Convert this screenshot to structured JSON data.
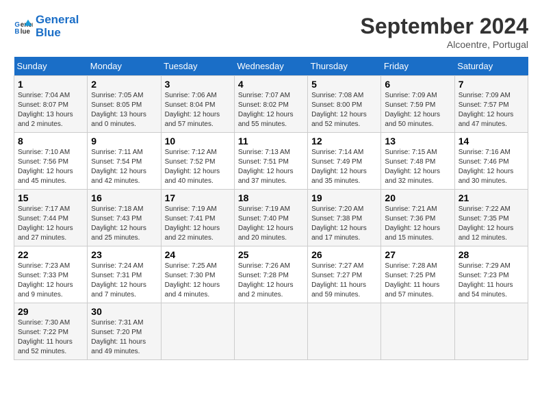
{
  "header": {
    "logo_line1": "General",
    "logo_line2": "Blue",
    "month": "September 2024",
    "location": "Alcoentre, Portugal"
  },
  "days_of_week": [
    "Sunday",
    "Monday",
    "Tuesday",
    "Wednesday",
    "Thursday",
    "Friday",
    "Saturday"
  ],
  "weeks": [
    [
      {
        "day": 1,
        "sunrise": "7:04 AM",
        "sunset": "8:07 PM",
        "daylight": "13 hours and 2 minutes"
      },
      {
        "day": 2,
        "sunrise": "7:05 AM",
        "sunset": "8:05 PM",
        "daylight": "13 hours and 0 minutes"
      },
      {
        "day": 3,
        "sunrise": "7:06 AM",
        "sunset": "8:04 PM",
        "daylight": "12 hours and 57 minutes"
      },
      {
        "day": 4,
        "sunrise": "7:07 AM",
        "sunset": "8:02 PM",
        "daylight": "12 hours and 55 minutes"
      },
      {
        "day": 5,
        "sunrise": "7:08 AM",
        "sunset": "8:00 PM",
        "daylight": "12 hours and 52 minutes"
      },
      {
        "day": 6,
        "sunrise": "7:09 AM",
        "sunset": "7:59 PM",
        "daylight": "12 hours and 50 minutes"
      },
      {
        "day": 7,
        "sunrise": "7:09 AM",
        "sunset": "7:57 PM",
        "daylight": "12 hours and 47 minutes"
      }
    ],
    [
      {
        "day": 8,
        "sunrise": "7:10 AM",
        "sunset": "7:56 PM",
        "daylight": "12 hours and 45 minutes"
      },
      {
        "day": 9,
        "sunrise": "7:11 AM",
        "sunset": "7:54 PM",
        "daylight": "12 hours and 42 minutes"
      },
      {
        "day": 10,
        "sunrise": "7:12 AM",
        "sunset": "7:52 PM",
        "daylight": "12 hours and 40 minutes"
      },
      {
        "day": 11,
        "sunrise": "7:13 AM",
        "sunset": "7:51 PM",
        "daylight": "12 hours and 37 minutes"
      },
      {
        "day": 12,
        "sunrise": "7:14 AM",
        "sunset": "7:49 PM",
        "daylight": "12 hours and 35 minutes"
      },
      {
        "day": 13,
        "sunrise": "7:15 AM",
        "sunset": "7:48 PM",
        "daylight": "12 hours and 32 minutes"
      },
      {
        "day": 14,
        "sunrise": "7:16 AM",
        "sunset": "7:46 PM",
        "daylight": "12 hours and 30 minutes"
      }
    ],
    [
      {
        "day": 15,
        "sunrise": "7:17 AM",
        "sunset": "7:44 PM",
        "daylight": "12 hours and 27 minutes"
      },
      {
        "day": 16,
        "sunrise": "7:18 AM",
        "sunset": "7:43 PM",
        "daylight": "12 hours and 25 minutes"
      },
      {
        "day": 17,
        "sunrise": "7:19 AM",
        "sunset": "7:41 PM",
        "daylight": "12 hours and 22 minutes"
      },
      {
        "day": 18,
        "sunrise": "7:19 AM",
        "sunset": "7:40 PM",
        "daylight": "12 hours and 20 minutes"
      },
      {
        "day": 19,
        "sunrise": "7:20 AM",
        "sunset": "7:38 PM",
        "daylight": "12 hours and 17 minutes"
      },
      {
        "day": 20,
        "sunrise": "7:21 AM",
        "sunset": "7:36 PM",
        "daylight": "12 hours and 15 minutes"
      },
      {
        "day": 21,
        "sunrise": "7:22 AM",
        "sunset": "7:35 PM",
        "daylight": "12 hours and 12 minutes"
      }
    ],
    [
      {
        "day": 22,
        "sunrise": "7:23 AM",
        "sunset": "7:33 PM",
        "daylight": "12 hours and 9 minutes"
      },
      {
        "day": 23,
        "sunrise": "7:24 AM",
        "sunset": "7:31 PM",
        "daylight": "12 hours and 7 minutes"
      },
      {
        "day": 24,
        "sunrise": "7:25 AM",
        "sunset": "7:30 PM",
        "daylight": "12 hours and 4 minutes"
      },
      {
        "day": 25,
        "sunrise": "7:26 AM",
        "sunset": "7:28 PM",
        "daylight": "12 hours and 2 minutes"
      },
      {
        "day": 26,
        "sunrise": "7:27 AM",
        "sunset": "7:27 PM",
        "daylight": "11 hours and 59 minutes"
      },
      {
        "day": 27,
        "sunrise": "7:28 AM",
        "sunset": "7:25 PM",
        "daylight": "11 hours and 57 minutes"
      },
      {
        "day": 28,
        "sunrise": "7:29 AM",
        "sunset": "7:23 PM",
        "daylight": "11 hours and 54 minutes"
      }
    ],
    [
      {
        "day": 29,
        "sunrise": "7:30 AM",
        "sunset": "7:22 PM",
        "daylight": "11 hours and 52 minutes"
      },
      {
        "day": 30,
        "sunrise": "7:31 AM",
        "sunset": "7:20 PM",
        "daylight": "11 hours and 49 minutes"
      },
      null,
      null,
      null,
      null,
      null
    ]
  ]
}
